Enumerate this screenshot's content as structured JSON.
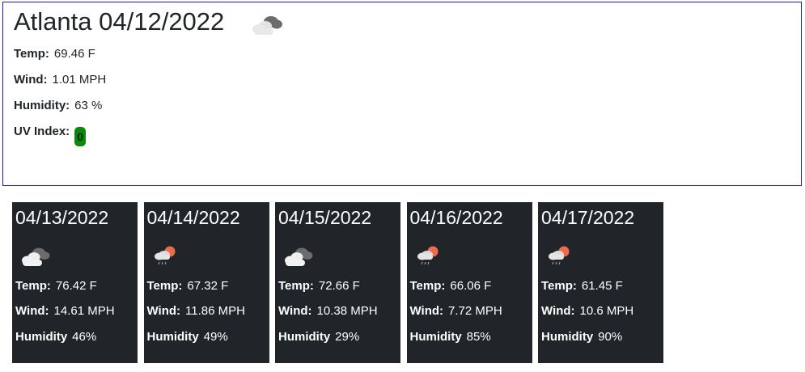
{
  "current": {
    "city_date": "Atlanta 04/12/2022",
    "icon": "broken-clouds-icon",
    "temp_label": "Temp:",
    "temp_value": "69.46 F",
    "wind_label": "Wind:",
    "wind_value": "1.01 MPH",
    "humidity_label": "Humidity:",
    "humidity_value": "63 %",
    "uv_label": "UV Index:",
    "uv_value": "0",
    "uv_color": "#0a8a0a"
  },
  "forecast": [
    {
      "date": "04/13/2022",
      "icon": "broken-clouds-icon",
      "temp_label": "Temp:",
      "temp": "76.42 F",
      "wind_label": "Wind:",
      "wind": "14.61 MPH",
      "humidity_label": "Humidity",
      "humidity": "46%"
    },
    {
      "date": "04/14/2022",
      "icon": "sun-rain-icon",
      "temp_label": "Temp:",
      "temp": "67.32 F",
      "wind_label": "Wind:",
      "wind": "11.86 MPH",
      "humidity_label": "Humidity",
      "humidity": "49%"
    },
    {
      "date": "04/15/2022",
      "icon": "broken-clouds-icon",
      "temp_label": "Temp:",
      "temp": "72.66 F",
      "wind_label": "Wind:",
      "wind": "10.38 MPH",
      "humidity_label": "Humidity",
      "humidity": "29%"
    },
    {
      "date": "04/16/2022",
      "icon": "sun-rain-icon",
      "temp_label": "Temp:",
      "temp": "66.06 F",
      "wind_label": "Wind:",
      "wind": "7.72 MPH",
      "humidity_label": "Humidity",
      "humidity": "85%"
    },
    {
      "date": "04/17/2022",
      "icon": "sun-rain-icon",
      "temp_label": "Temp:",
      "temp": "61.45 F",
      "wind_label": "Wind:",
      "wind": "10.6 MPH",
      "humidity_label": "Humidity",
      "humidity": "90%"
    }
  ],
  "colors": {
    "card_bg": "#212529",
    "border": "#1a1ac0"
  }
}
